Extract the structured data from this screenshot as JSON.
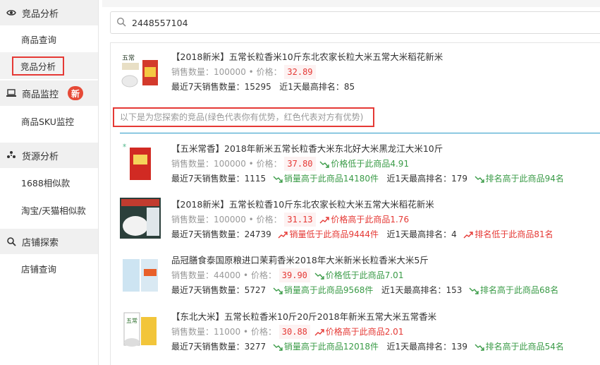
{
  "sidebar": {
    "sections": [
      {
        "label": "竞品分析",
        "icon": "eye-icon",
        "items": [
          {
            "label": "商品查询",
            "active": false
          },
          {
            "label": "竞品分析",
            "active": true
          }
        ]
      },
      {
        "label": "商品监控",
        "icon": "laptop-icon",
        "badge": "新",
        "items": [
          {
            "label": "商品SKU监控",
            "active": false
          }
        ]
      },
      {
        "label": "货源分析",
        "icon": "pinwheel-icon",
        "items": [
          {
            "label": "1688相似款",
            "active": false
          },
          {
            "label": "淘宝/天猫相似款",
            "active": false
          }
        ]
      },
      {
        "label": "店铺探索",
        "icon": "search-icon",
        "items": [
          {
            "label": "店铺查询",
            "active": false
          }
        ]
      }
    ]
  },
  "search": {
    "value": "2448557104"
  },
  "target": {
    "title": "【2018新米】五常长粒香米10斤东北农家长粒大米五常大米稻花新米",
    "sales_label": "销售数量：",
    "sales": "100000",
    "price_label": "价格：",
    "price": "32.89",
    "recent_label": "最近7天销售数量：",
    "recent": "15295",
    "rank_label": "近1天最高排名：",
    "rank": "85"
  },
  "notice": "以下是为您探索的竞品(绿色代表你有优势，红色代表对方有优势)",
  "competitors": [
    {
      "title": "【五米常香】2018年新米五常长粒香大米东北好大米黑龙江大米10斤",
      "sales": "100000",
      "price": "37.80",
      "price_cmp": "价格低于此商品4.91",
      "price_adv": "green",
      "recent": "1115",
      "sales_cmp": "销量高于此商品14180件",
      "sales_adv": "green",
      "rank_label": "近1天最高排名：",
      "rank": "179",
      "rank_cmp": "排名高于此商品94名",
      "rank_adv": "green"
    },
    {
      "title": "【2018新米】五常长粒香10斤东北农家长粒大米五常大米稻花新米",
      "sales": "100000",
      "price": "31.13",
      "price_cmp": "价格高于此商品1.76",
      "price_adv": "red",
      "recent": "24739",
      "sales_cmp": "销量低于此商品9444件",
      "sales_adv": "red",
      "rank_label": "近1天最高排名：",
      "rank": "4",
      "rank_cmp": "排名低于此商品81名",
      "rank_adv": "red"
    },
    {
      "title": "品冠膳食泰国原粮进口茉莉香米2018年大米新米长粒香米大米5斤",
      "sales": "44000",
      "price": "39.90",
      "price_cmp": "价格低于此商品7.01",
      "price_adv": "green",
      "recent": "5727",
      "sales_cmp": "销量高于此商品9568件",
      "sales_adv": "green",
      "rank_label": "近1天最高排名：",
      "rank": "153",
      "rank_cmp": "排名高于此商品68名",
      "rank_adv": "green"
    },
    {
      "title": "【东北大米】五常长粒香米10斤20斤2018年新米五常大米五常香米",
      "sales": "11000",
      "price": "30.88",
      "price_cmp": "价格高于此商品2.01",
      "price_adv": "red",
      "recent": "3277",
      "sales_cmp": "销量高于此商品12018件",
      "sales_adv": "green",
      "rank_label": "近1天最高排名：",
      "rank": "139",
      "rank_cmp": "排名高于此商品54名",
      "rank_adv": "green"
    }
  ],
  "labels": {
    "sales": "销售数量：",
    "price": "价格：",
    "recent": "最近7天销售数量："
  },
  "colors": {
    "advantage": "#3a9b47",
    "disadvantage": "#e53935",
    "accent": "#2a9ac8"
  }
}
